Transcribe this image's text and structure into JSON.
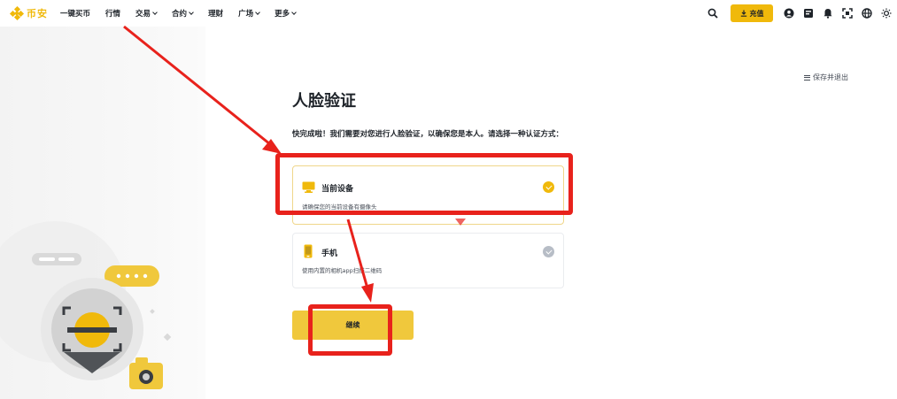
{
  "nav": {
    "logo_text": "币安",
    "items": [
      {
        "label": "一键买币",
        "dropdown": false
      },
      {
        "label": "行情",
        "dropdown": false
      },
      {
        "label": "交易",
        "dropdown": true
      },
      {
        "label": "合约",
        "dropdown": true
      },
      {
        "label": "理财",
        "dropdown": false
      },
      {
        "label": "广场",
        "dropdown": true
      },
      {
        "label": "更多",
        "dropdown": true
      }
    ],
    "deposit_label": "充值",
    "right_icons": [
      "search-icon",
      "account-icon",
      "orders-icon",
      "notification-icon",
      "download-icon",
      "language-icon",
      "theme-icon"
    ]
  },
  "page": {
    "save_exit_label": "保存并退出",
    "title": "人脸验证",
    "description": "快完成啦！我们需要对您进行人脸验证，以确保您是本人。请选择一种认证方式：",
    "options": [
      {
        "title": "当前设备",
        "subtitle": "请确保您的当前设备有摄像头",
        "icon": "monitor-icon",
        "selected": true
      },
      {
        "title": "手机",
        "subtitle": "使用内置的相机app扫描二维码",
        "icon": "phone-icon",
        "selected": false
      }
    ],
    "continue_label": "继续"
  },
  "colors": {
    "brand": "#f0b90b",
    "annotation": "#e8221c",
    "text": "#1e2329"
  }
}
